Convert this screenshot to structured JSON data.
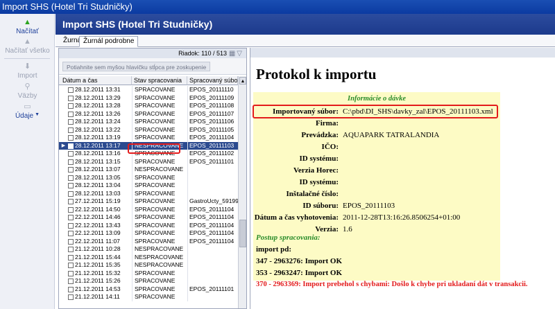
{
  "window": {
    "title": "Import SHS (Hotel Tri Studničky)"
  },
  "sidebar": {
    "nacitat": "Načítať",
    "nacitat_vsetko": "Načítať všetko",
    "import": "Import",
    "vazby": "Väzby",
    "udaje": "Údaje"
  },
  "header": {
    "title": "Import SHS (Hotel Tri Studničky)"
  },
  "tabs": {
    "zurnal": "Žurnál",
    "zurnal_podrobne": "Žurnál podrobne"
  },
  "grid": {
    "row_count": "Riadok: 110 / 513",
    "group_hint": "Potiahnite sem myšou hlavičku stĺpca pre zoskupenie",
    "col_date": "Dátum a čas",
    "col_status": "Stav spracovania",
    "col_file": "Spracovaný súbor",
    "rows": [
      {
        "d": "28.12.2011 13:31",
        "s": "SPRACOVANE",
        "f": "EPOS_20111110"
      },
      {
        "d": "28.12.2011 13:29",
        "s": "SPRACOVANE",
        "f": "EPOS_20111109"
      },
      {
        "d": "28.12.2011 13:28",
        "s": "SPRACOVANE",
        "f": "EPOS_20111108"
      },
      {
        "d": "28.12.2011 13:26",
        "s": "SPRACOVANE",
        "f": "EPOS_20111107"
      },
      {
        "d": "28.12.2011 13:24",
        "s": "SPRACOVANE",
        "f": "EPOS_20111106"
      },
      {
        "d": "28.12.2011 13:22",
        "s": "SPRACOVANE",
        "f": "EPOS_20111105"
      },
      {
        "d": "28.12.2011 13:19",
        "s": "SPRACOVANE",
        "f": "EPOS_20111104"
      },
      {
        "d": "28.12.2011 13:17",
        "s": "NESPRACOVANE",
        "f": "EPOS_20111103"
      },
      {
        "d": "28.12.2011 13:16",
        "s": "SPRACOVANE",
        "f": "EPOS_20111102"
      },
      {
        "d": "28.12.2011 13:15",
        "s": "SPRACOVANE",
        "f": "EPOS_20111101"
      },
      {
        "d": "28.12.2011 13:07",
        "s": "NESPRACOVANE",
        "f": ""
      },
      {
        "d": "28.12.2011 13:05",
        "s": "SPRACOVANE",
        "f": ""
      },
      {
        "d": "28.12.2011 13:04",
        "s": "SPRACOVANE",
        "f": ""
      },
      {
        "d": "28.12.2011 13:03",
        "s": "SPRACOVANE",
        "f": ""
      },
      {
        "d": "27.12.2011 15:19",
        "s": "SPRACOVANE",
        "f": "GastroUcty_59199..."
      },
      {
        "d": "22.12.2011 14:50",
        "s": "SPRACOVANE",
        "f": "EPOS_20111104"
      },
      {
        "d": "22.12.2011 14:46",
        "s": "SPRACOVANE",
        "f": "EPOS_20111104"
      },
      {
        "d": "22.12.2011 13:43",
        "s": "SPRACOVANE",
        "f": "EPOS_20111104"
      },
      {
        "d": "22.12.2011 13:09",
        "s": "SPRACOVANE",
        "f": "EPOS_20111104"
      },
      {
        "d": "22.12.2011 11:07",
        "s": "SPRACOVANE",
        "f": "EPOS_20111104"
      },
      {
        "d": "21.12.2011 10:28",
        "s": "NESPRACOVANE",
        "f": ""
      },
      {
        "d": "21.12.2011 15:44",
        "s": "NESPRACOVANE",
        "f": ""
      },
      {
        "d": "21.12.2011 15:35",
        "s": "NESPRACOVANE",
        "f": ""
      },
      {
        "d": "21.12.2011 15:32",
        "s": "SPRACOVANE",
        "f": ""
      },
      {
        "d": "21.12.2011 15:26",
        "s": "SPRACOVANE",
        "f": ""
      },
      {
        "d": "21.12.2011 14:53",
        "s": "SPRACOVANE",
        "f": "EPOS_20111101"
      },
      {
        "d": "21.12.2011 14:11",
        "s": "SPRACOVANE",
        "f": ""
      }
    ]
  },
  "protocol": {
    "title": "Protokol k importu",
    "info_header": "Informácie o dávke",
    "labels": {
      "imported_file": "Importovaný súbor:",
      "firma": "Firma:",
      "prevadzka": "Prevádzka:",
      "ico": "IČO:",
      "id_systemu": "ID systému:",
      "verzia_horec": "Verzia Horec:",
      "id_systemu2": "ID systému:",
      "instalacne_cislo": "Inštalačné číslo:",
      "id_suboru": "ID súboru:",
      "datum_vyhotovenia": "Dátum a čas vyhotovenia:",
      "verzia": "Verzia:"
    },
    "values": {
      "imported_file": "C:\\pbd\\DI_SHS\\davky_zal\\EPOS_20111103.xml",
      "firma": "",
      "prevadzka": "AQUAPARK TATRALANDIA",
      "ico": "",
      "id_systemu": "",
      "verzia_horec": "",
      "id_systemu2": "",
      "instalacne_cislo": "",
      "id_suboru": "EPOS_20111103",
      "datum_vyhotovenia": "2011-12-28T13:16:26.8506254+01:00",
      "verzia": "1.6"
    },
    "processing_header": "Postup spracovania:",
    "import_pd": "import pd:",
    "log": [
      {
        "text": "347 - 2963276: Import OK",
        "status": "ok"
      },
      {
        "text": "353 - 2963247: Import OK",
        "status": "ok"
      },
      {
        "text": "370 - 2963369: Import prebehol s chybami: Došlo k chybe pri ukladaní dát v transakcii.",
        "status": "error"
      }
    ]
  }
}
